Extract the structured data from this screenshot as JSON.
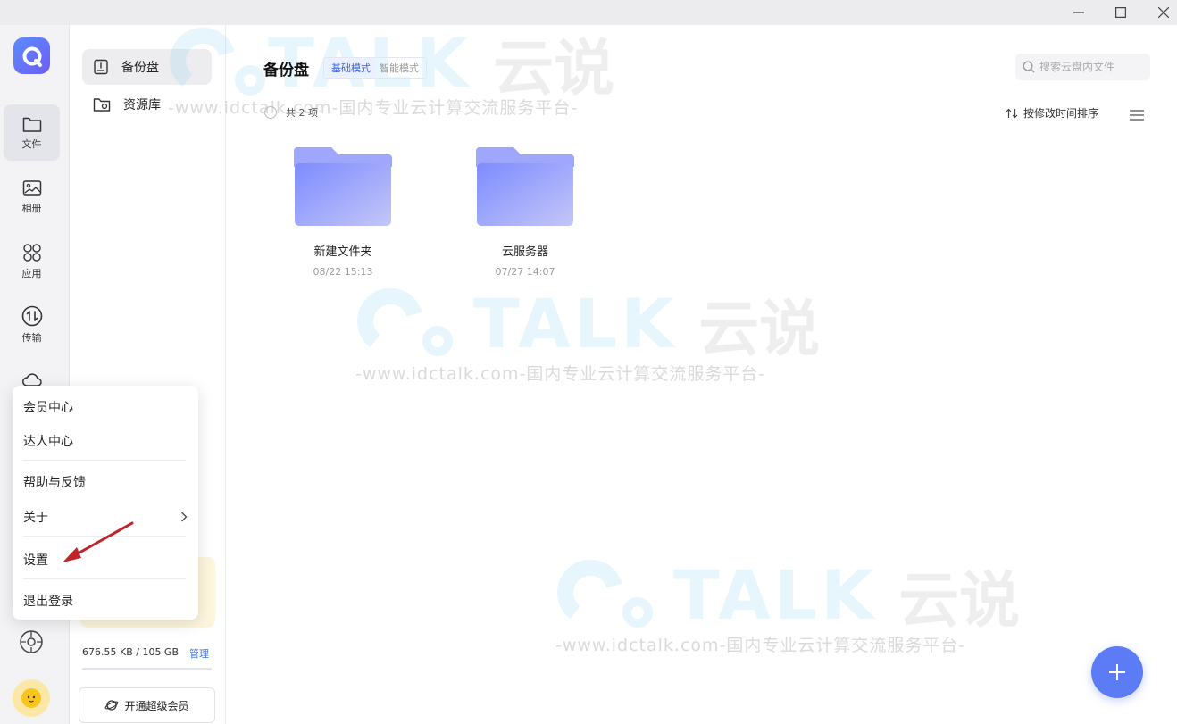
{
  "rail": {
    "items": [
      {
        "label": "文件"
      },
      {
        "label": "相册"
      },
      {
        "label": "应用"
      },
      {
        "label": "传输"
      }
    ]
  },
  "sidebar": {
    "items": [
      {
        "label": "备份盘"
      },
      {
        "label": "资源库"
      }
    ],
    "storage_text": "676.55 KB / 105 GB",
    "manage_label": "管理",
    "storage_used_fraction": 1e-05,
    "vip_label": "开通超级会员"
  },
  "main": {
    "title": "备份盘",
    "modes": [
      "基础模式",
      "智能模式"
    ],
    "search_placeholder": "搜索云盘内文件",
    "count_label": "共 2 项",
    "sort_label": "按修改时间排序",
    "folders": [
      {
        "name": "新建文件夹",
        "date": "08/22 15:13"
      },
      {
        "name": "云服务器",
        "date": "07/27 14:07"
      }
    ]
  },
  "menu": {
    "items": [
      "会员中心",
      "达人中心",
      "帮助与反馈",
      "关于",
      "设置",
      "退出登录"
    ]
  },
  "watermark": {
    "brand": "TALK",
    "brand_cn": "云说",
    "sub": "-www.idctalk.com-国内专业云计算交流服务平台-"
  },
  "colors": {
    "accent": "#5b7cf5",
    "folder": "#8f9dfa",
    "arrow": "#c0242a"
  }
}
